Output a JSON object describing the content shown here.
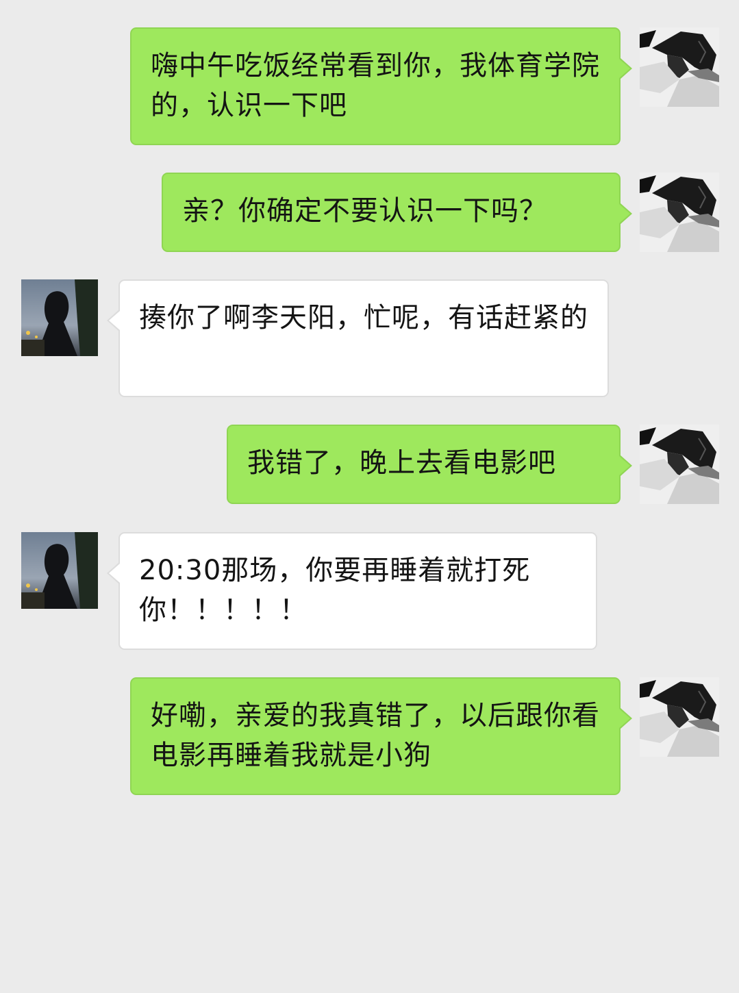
{
  "conversation": {
    "messages": [
      {
        "side": "sent",
        "text": "嗨中午吃饭经常看到你，我体育学院的，认识一下吧"
      },
      {
        "side": "sent",
        "text": "亲？你确定不要认识一下吗？"
      },
      {
        "side": "received",
        "text": "揍你了啊李天阳，忙呢，有话赶紧的"
      },
      {
        "side": "sent",
        "text": "我错了，晚上去看电影吧"
      },
      {
        "side": "received",
        "text": "20:30那场，你要再睡着就打死你！！！！！"
      },
      {
        "side": "sent",
        "text": "好嘞，亲爱的我真错了，以后跟你看电影再睡着我就是小狗"
      }
    ]
  },
  "avatars": {
    "sent": {
      "icon": "manga-boy-avatar-icon"
    },
    "received": {
      "icon": "girl-silhouette-avatar-icon"
    }
  },
  "colors": {
    "background": "#ebebeb",
    "sent_bubble": "#9ee85d",
    "received_bubble": "#ffffff"
  }
}
